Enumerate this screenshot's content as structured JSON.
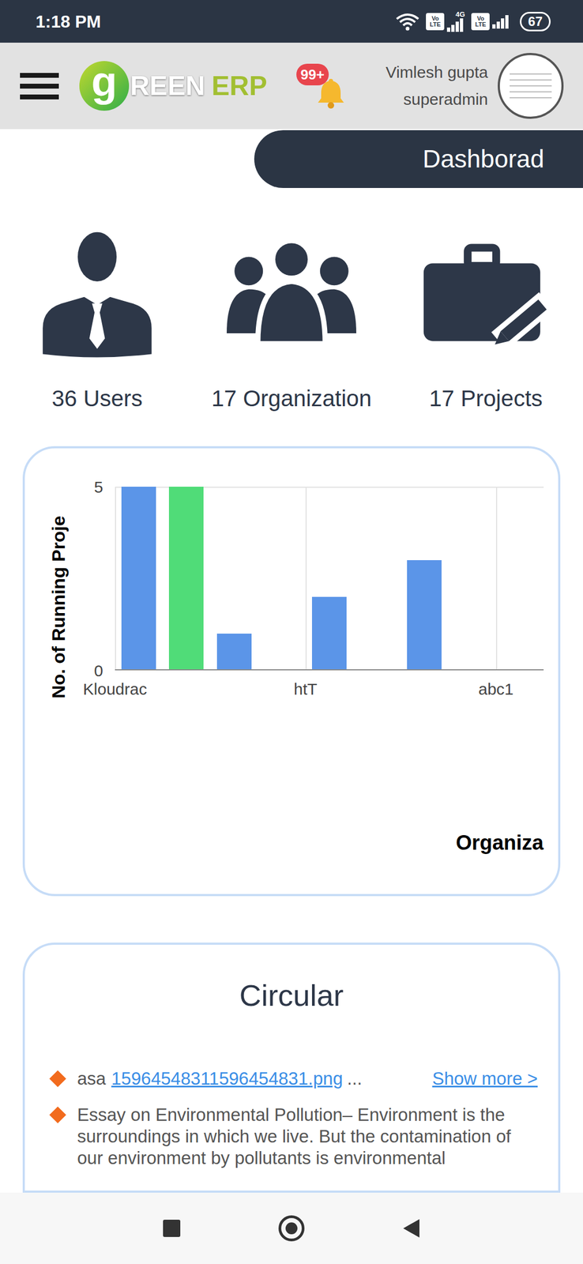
{
  "status_bar": {
    "time": "1:18 PM",
    "sims": [
      {
        "top": "Vo",
        "bottom": "LTE",
        "network": "4G"
      },
      {
        "top": "Vo",
        "bottom": "LTE"
      }
    ],
    "battery": "67"
  },
  "header": {
    "logo": {
      "mark": "g",
      "text": "REEN",
      "suffix": "ERP"
    },
    "notifications": "99+",
    "user_name": "Vimlesh gupta",
    "role": "superadmin"
  },
  "page_title": "Dashborad",
  "stats": [
    {
      "count": "36",
      "label": "Users"
    },
    {
      "count": "17",
      "label": "Organization"
    },
    {
      "count": "17",
      "label": "Projects"
    }
  ],
  "chart": {
    "y_axis_title": "No. of Running Proje",
    "x_axis_title": "Organiza",
    "y_ticks": [
      "5",
      "0"
    ],
    "bars": [
      {
        "value": 5,
        "color": "#5b95e8",
        "label": "Kloudrac"
      },
      {
        "value": 5,
        "color": "#50dc78",
        "label": ""
      },
      {
        "value": 1,
        "color": "#5b95e8",
        "label": ""
      },
      {
        "value": 0,
        "color": "#5b95e8",
        "label": ""
      },
      {
        "value": 2,
        "color": "#5b95e8",
        "label": "htT"
      },
      {
        "value": 0,
        "color": "#5b95e8",
        "label": ""
      },
      {
        "value": 3,
        "color": "#5b95e8",
        "label": ""
      },
      {
        "value": 0,
        "color": "#5b95e8",
        "label": ""
      },
      {
        "value": 0,
        "color": "#5b95e8",
        "label": "abc1"
      }
    ]
  },
  "circular": {
    "title": "Circular",
    "items": [
      {
        "kind": "attachment",
        "prefix": "asa",
        "link": "15964548311596454831.png",
        "ellipsis": "...",
        "action": "Show more >"
      },
      {
        "kind": "text",
        "text": "Essay on Environmental Pollution– Environment is the surroundings in which we live. But the contamination of our environment by pollutants is environmental"
      }
    ]
  }
}
